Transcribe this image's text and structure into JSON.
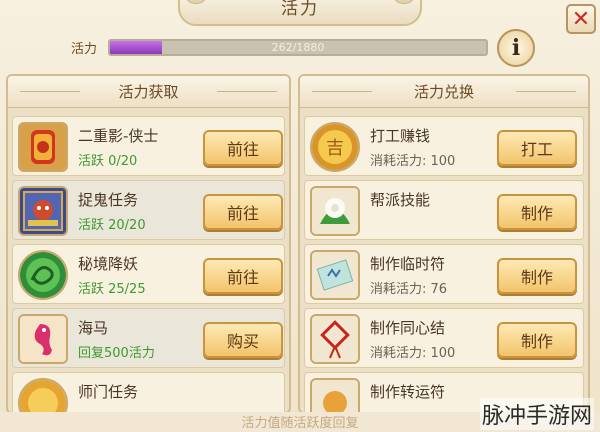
{
  "title": "活力",
  "vigor": {
    "label": "活力",
    "current": 262,
    "max": 1880,
    "text": "262/1880",
    "fill_color": "#a24ccd"
  },
  "info_button": "i",
  "close_button": "✕",
  "left_panel": {
    "title": "活力获取",
    "rows": [
      {
        "name": "二重影-侠士",
        "status": "活跃 0/20",
        "button": "前往",
        "icon": "lantern-icon"
      },
      {
        "name": "捉鬼任务",
        "status": "活跃 20/20",
        "button": "前往",
        "icon": "demon-icon"
      },
      {
        "name": "秘境降妖",
        "status": "活跃 25/25",
        "button": "前往",
        "icon": "jade-dragon-icon"
      },
      {
        "name": "海马",
        "status": "回复500活力",
        "button": "购买",
        "icon": "seahorse-icon"
      },
      {
        "name": "师门任务",
        "status": "",
        "button": "",
        "icon": "coin-icon"
      }
    ]
  },
  "right_panel": {
    "title": "活力兑换",
    "rows": [
      {
        "name": "打工赚钱",
        "cost": "消耗活力: 100",
        "button": "打工",
        "icon": "gold-coin-icon"
      },
      {
        "name": "帮派技能",
        "cost": "",
        "button": "制作",
        "icon": "white-flower-icon"
      },
      {
        "name": "制作临时符",
        "cost": "消耗活力: 76",
        "button": "制作",
        "icon": "talisman-icon"
      },
      {
        "name": "制作同心结",
        "cost": "消耗活力: 100",
        "button": "制作",
        "icon": "chinese-knot-icon"
      },
      {
        "name": "制作转运符",
        "cost": "",
        "button": "",
        "icon": "fortune-icon"
      }
    ]
  },
  "footer": "活力值随活跃度回复",
  "watermark": "脉冲手游网"
}
